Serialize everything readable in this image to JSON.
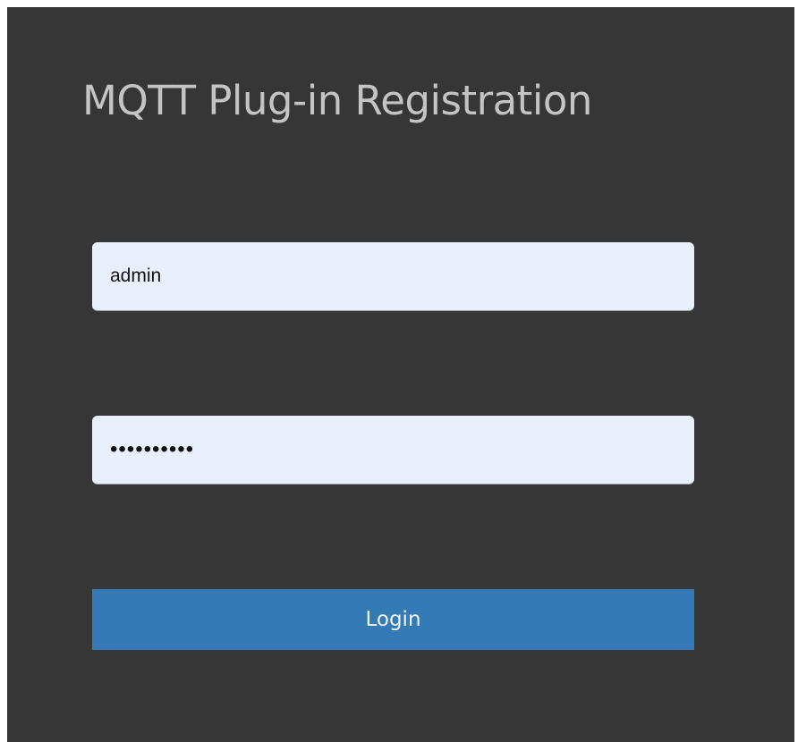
{
  "page": {
    "title": "MQTT Plug-in Registration"
  },
  "form": {
    "username_value": "admin",
    "password_value": "••••••••••",
    "login_label": "Login"
  },
  "colors": {
    "panel_bg": "#363636",
    "title_text": "#c4c4c4",
    "input_bg": "#e8f0fe",
    "button_bg": "#337ab7",
    "button_text": "#f4f4f4"
  }
}
